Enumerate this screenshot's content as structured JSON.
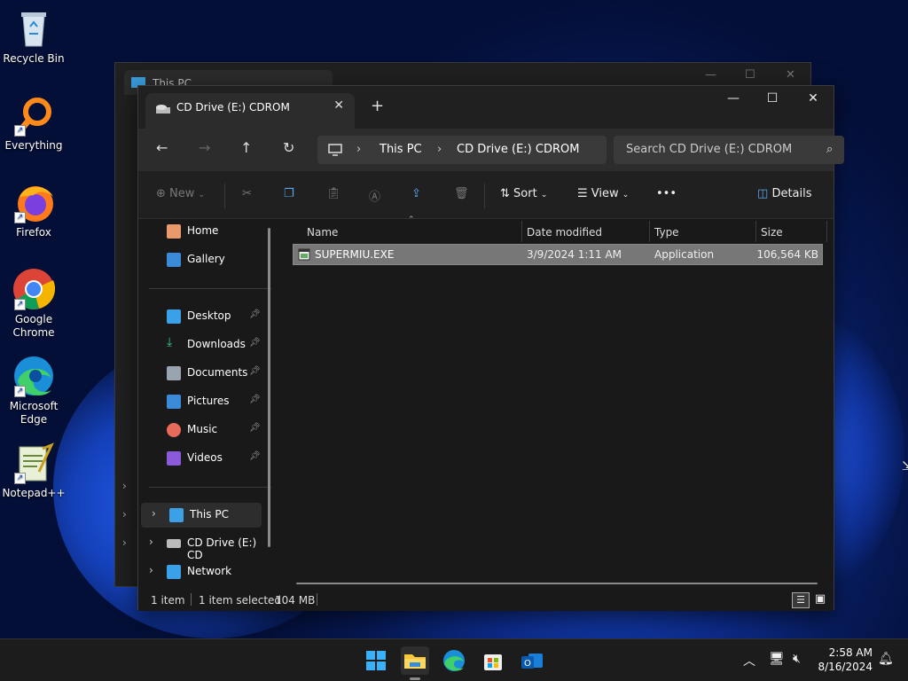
{
  "desktop": {
    "icons": [
      {
        "label": "Recycle Bin"
      },
      {
        "label": "Everything"
      },
      {
        "label": "Firefox"
      },
      {
        "label": "Google\nChrome"
      },
      {
        "label": "Microsoft\nEdge"
      },
      {
        "label": "Notepad++"
      }
    ]
  },
  "background_window": {
    "tab_title": "This PC"
  },
  "window": {
    "tab_title": "CD Drive (E:) CDROM",
    "new_tab": "+",
    "controls": {
      "minimize": "—",
      "maximize": "☐",
      "close": "✕"
    },
    "address": {
      "segments": [
        "This PC",
        "CD Drive (E:) CDROM"
      ]
    },
    "search": {
      "placeholder": "Search CD Drive (E:) CDROM"
    },
    "toolbar": {
      "new_label": "New",
      "sort_label": "Sort",
      "view_label": "View",
      "more_label": "•••",
      "details_label": "Details"
    },
    "sidebar": {
      "items": [
        {
          "label": "Home"
        },
        {
          "label": "Gallery"
        },
        {
          "label": "Desktop"
        },
        {
          "label": "Downloads"
        },
        {
          "label": "Documents"
        },
        {
          "label": "Pictures"
        },
        {
          "label": "Music"
        },
        {
          "label": "Videos"
        },
        {
          "label": "This PC"
        },
        {
          "label": "CD Drive (E:) CD"
        },
        {
          "label": "Network"
        }
      ]
    },
    "columns": [
      "Name",
      "Date modified",
      "Type",
      "Size"
    ],
    "files": [
      {
        "name": "SUPERMIU.EXE",
        "date": "3/9/2024 1:11 AM",
        "type": "Application",
        "size": "106,564 KB"
      }
    ],
    "status": {
      "count": "1 item",
      "selected": "1 item selected",
      "size": "104 MB"
    }
  },
  "taskbar": {
    "time": "2:58 AM",
    "date": "8/16/2024"
  },
  "colors": {
    "accent": "#0078d4",
    "selection": "#777777"
  }
}
